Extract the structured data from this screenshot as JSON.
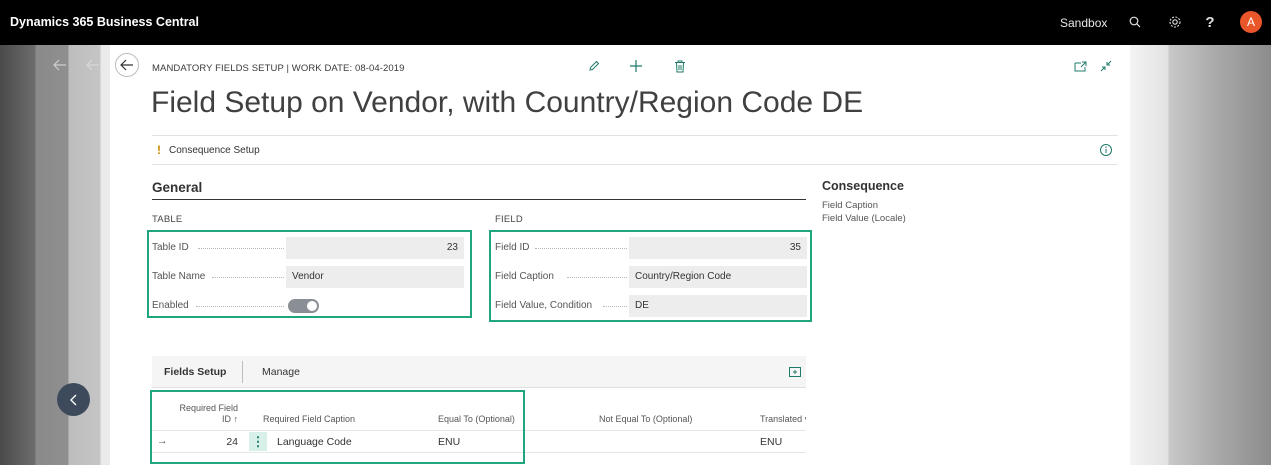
{
  "topbar": {
    "brand": "Dynamics 365 Business Central",
    "environment": "Sandbox",
    "avatar_letter": "A"
  },
  "header": {
    "caption": "MANDATORY FIELDS SETUP | WORK DATE: 08-04-2019",
    "title": "Field Setup on Vendor, with Country/Region Code DE"
  },
  "consequence_bar": {
    "marker": "!",
    "label": "Consequence Setup"
  },
  "general": {
    "title": "General",
    "table_group": "TABLE",
    "field_group": "FIELD",
    "table_fields": [
      {
        "label": "Table ID",
        "value": "23"
      },
      {
        "label": "Table Name",
        "value": "Vendor"
      },
      {
        "label": "Enabled",
        "value": "on"
      }
    ],
    "field_fields": [
      {
        "label": "Field ID",
        "value": "35"
      },
      {
        "label": "Field Caption",
        "value": "Country/Region Code"
      },
      {
        "label": "Field Value, Condition",
        "value": "DE"
      }
    ]
  },
  "side_panel": {
    "title": "Consequence",
    "items": [
      "Field Caption",
      "Field Value (Locale)"
    ]
  },
  "part": {
    "tabs": [
      "Fields Setup",
      "Manage"
    ],
    "columns": [
      "Required Field ID ↑",
      "Required Field Caption",
      "Equal To (Optional)",
      "Not Equal To (Optional)",
      "Translated v"
    ],
    "rows": [
      {
        "id": "24",
        "caption": "Language Code",
        "equal_to": "ENU",
        "not_equal_to": "",
        "translated": "ENU"
      }
    ]
  },
  "colors": {
    "highlight": "#1fa67e",
    "avatar": "#e8562a",
    "topbar": "#000000"
  }
}
